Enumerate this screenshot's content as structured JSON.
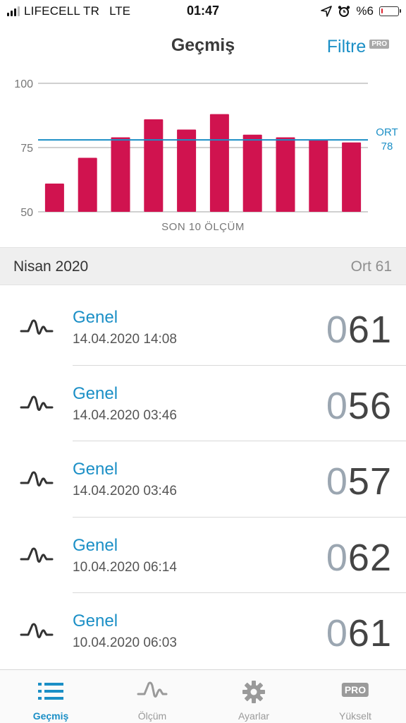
{
  "status_bar": {
    "carrier": "LIFECELL TR",
    "network": "LTE",
    "time": "01:47",
    "battery_text": "%6",
    "battery_level_percent": 6,
    "battery_color": "#e0222e"
  },
  "nav": {
    "title": "Geçmiş",
    "filter_label": "Filtre",
    "pro_badge": "PRO"
  },
  "chart_data": {
    "type": "bar",
    "categories": [
      "1",
      "2",
      "3",
      "4",
      "5",
      "6",
      "7",
      "8",
      "9",
      "10"
    ],
    "values": [
      61,
      71,
      79,
      86,
      82,
      88,
      80,
      79,
      78,
      77
    ],
    "ylim": [
      50,
      100
    ],
    "yticks": [
      50,
      75,
      100
    ],
    "xlabel": "SON 10 ÖLÇÜM",
    "average": {
      "label": "ORT",
      "value": 78
    },
    "bar_color": "#d0134f",
    "average_color": "#1b8fc6",
    "grid": true
  },
  "section": {
    "title": "Nisan 2020",
    "average": "Ort 61"
  },
  "records": [
    {
      "type": "Genel",
      "datetime": "14.04.2020 14:08",
      "value_lead": "0",
      "value_main": "61"
    },
    {
      "type": "Genel",
      "datetime": "14.04.2020 03:46",
      "value_lead": "0",
      "value_main": "56"
    },
    {
      "type": "Genel",
      "datetime": "14.04.2020 03:46",
      "value_lead": "0",
      "value_main": "57"
    },
    {
      "type": "Genel",
      "datetime": "10.04.2020 06:14",
      "value_lead": "0",
      "value_main": "62"
    },
    {
      "type": "Genel",
      "datetime": "10.04.2020 06:03",
      "value_lead": "0",
      "value_main": "61"
    }
  ],
  "tabs": [
    {
      "label": "Geçmiş",
      "icon": "list-icon",
      "active": true
    },
    {
      "label": "Ölçüm",
      "icon": "pulse-wave-icon",
      "active": false
    },
    {
      "label": "Ayarlar",
      "icon": "gear-icon",
      "active": false
    },
    {
      "label": "Yükselt",
      "icon": "pro-badge-icon",
      "badge": "PRO",
      "active": false
    }
  ]
}
